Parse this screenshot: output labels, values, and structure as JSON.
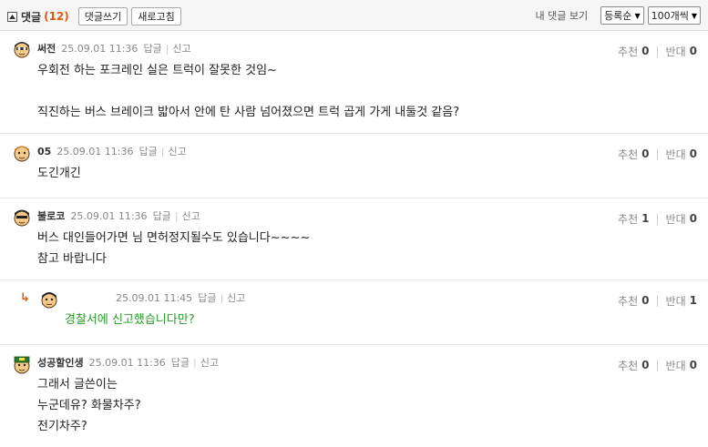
{
  "header": {
    "title": "댓글",
    "count": "(12)",
    "write_button": "댓글쓰기",
    "refresh_button": "새로고침",
    "my_comments": "내 댓글 보기",
    "sort_select": "등록순",
    "per_page_select": "100개씩"
  },
  "labels": {
    "reply": "답글",
    "report": "신고",
    "recommend": "추천",
    "oppose": "반대"
  },
  "comments": [
    {
      "nick": "써전",
      "date": "25.09.01 11:36",
      "up": "0",
      "down": "0",
      "lines": [
        "우회전 하는 포크레인 실은 트럭이 잘못한 것임~",
        "",
        "직진하는 버스 브레이크 밟아서 안에 탄 사람 넘어졌으면 트럭 곱게 가게 내둘것 같음?"
      ]
    },
    {
      "nick": "05",
      "date": "25.09.01 11:36",
      "up": "0",
      "down": "0",
      "lines": [
        "도긴개긴"
      ]
    },
    {
      "nick": "불로코",
      "date": "25.09.01 11:36",
      "up": "1",
      "down": "0",
      "lines": [
        "버스 대인들어가면 님 면허정지될수도 있습니다~~~~",
        "참고 바랍니다"
      ]
    },
    {
      "nick": "",
      "date": "25.09.01 11:45",
      "up": "0",
      "down": "1",
      "lines": [
        "경찰서에 신고했습니다만?"
      ]
    },
    {
      "nick": "성공할인생",
      "date": "25.09.01 11:36",
      "up": "0",
      "down": "0",
      "lines": [
        "그래서 글쓴이는",
        "누군데유? 화물차주?",
        "전기차주?"
      ]
    }
  ]
}
